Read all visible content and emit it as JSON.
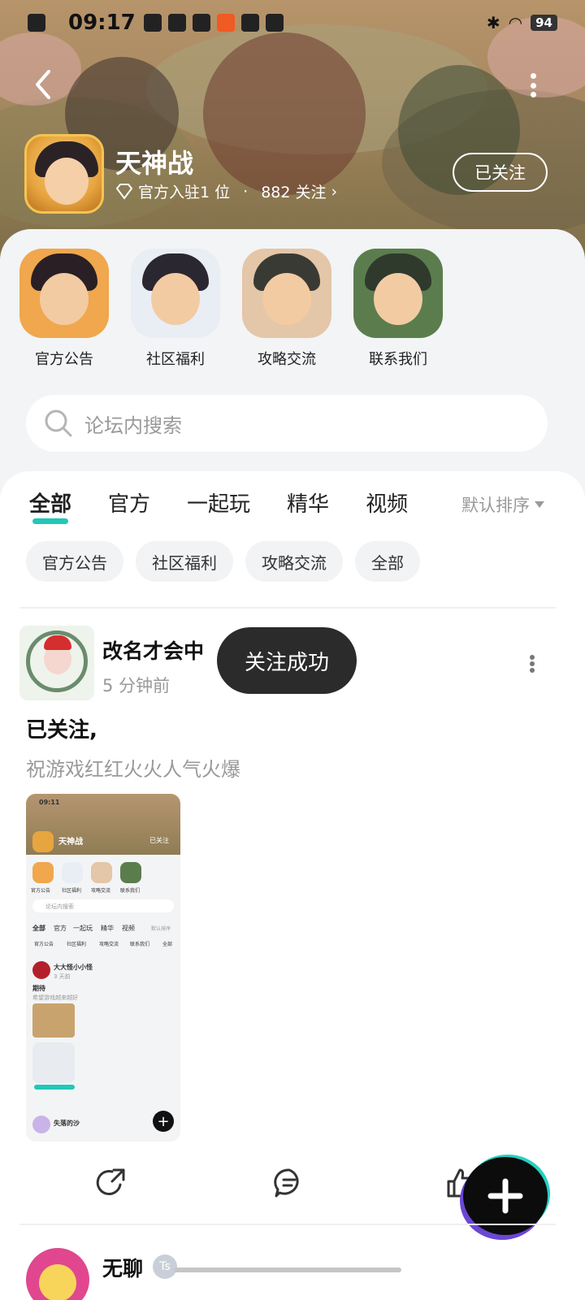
{
  "status_bar": {
    "time": "09:17",
    "battery": "94"
  },
  "header": {
    "title": "天神战",
    "meta_official": "官方入驻1 位",
    "meta_sep": "·",
    "meta_follow": "882 关注",
    "follow_button": "已关注"
  },
  "shortcuts": [
    {
      "label": "官方公告",
      "hair": "#2a1f24",
      "bg": "#f0a74d"
    },
    {
      "label": "社区福利",
      "hair": "#2b2730",
      "bg": "#e9eef5"
    },
    {
      "label": "攻略交流",
      "hair": "#3a3a35",
      "bg": "#e4c6a8"
    },
    {
      "label": "联系我们",
      "hair": "#2f3a2d",
      "bg": "#5b7d4e"
    }
  ],
  "search": {
    "placeholder": "论坛内搜索"
  },
  "tabs": [
    {
      "label": "全部",
      "active": true
    },
    {
      "label": "官方",
      "active": false
    },
    {
      "label": "一起玩",
      "active": false
    },
    {
      "label": "精华",
      "active": false
    },
    {
      "label": "视频",
      "active": false
    }
  ],
  "sort_label": "默认排序",
  "chips": [
    "官方公告",
    "社区福利",
    "攻略交流",
    "全部"
  ],
  "post": {
    "author": "改名才会中",
    "time": "5  分钟前",
    "title": "已关注,",
    "body": "祝游戏红红火火人气火爆",
    "screenshot": {
      "time": "09:11",
      "title": "天神战",
      "follow": "已关注",
      "search": "论坛内搜索",
      "tabs": [
        "全部",
        "官方",
        "一起玩",
        "精华",
        "视频"
      ],
      "sort": "默认排序",
      "chips": [
        "官方公告",
        "社区福利",
        "攻略交流",
        "联系我们",
        "全部"
      ],
      "shortcuts": [
        "官方公告",
        "社区福利",
        "攻略交流",
        "联系我们"
      ],
      "post_author": "大大怪小小怪",
      "post_time": "3 天前",
      "post_title": "期待",
      "post_body": "希望游戏越来越好",
      "next_author": "失落的沙"
    }
  },
  "toast": "关注成功",
  "next_post": {
    "author": "无聊",
    "badge": "Ts"
  },
  "colors": {
    "accent": "#21c7b8",
    "fab": "#0c0c0c"
  }
}
